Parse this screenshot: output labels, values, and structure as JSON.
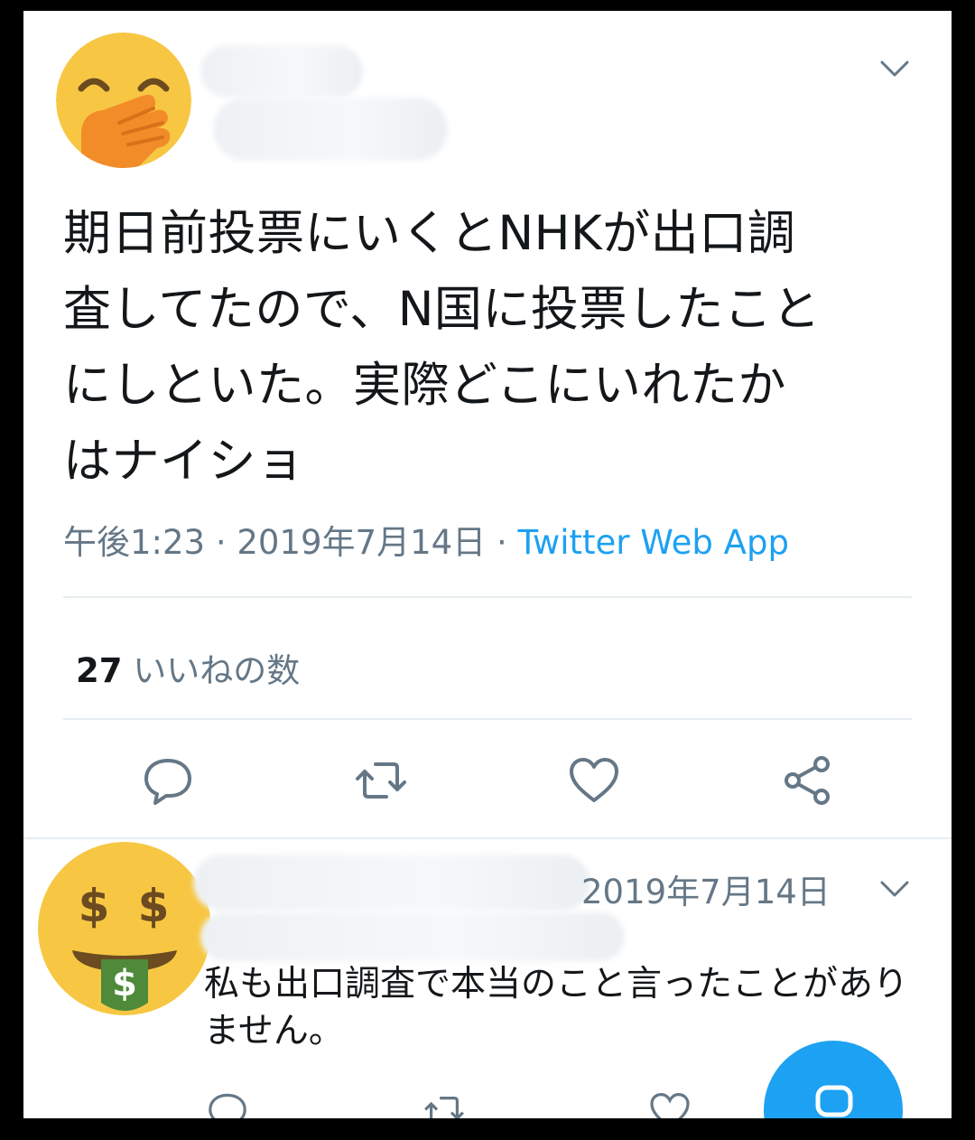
{
  "tweet": {
    "text_lines": [
      "期日前投票にいくとNHKが出口調",
      "査してたので、N国に投票したこと",
      "にしといた。実際どこにいれたか",
      "はナイショ"
    ],
    "time": "午後1:23",
    "separator": " · ",
    "date": "2019年7月14日",
    "source": "Twitter Web App",
    "likes_count": "27",
    "likes_label": "いいねの数",
    "avatar_icon": "face-with-hand-over-mouth-emoji",
    "actions": [
      "reply-icon",
      "retweet-icon",
      "like-icon",
      "share-icon"
    ]
  },
  "reply": {
    "date": "2019年7月14日",
    "text": "私も出口調査で本当のこと言ったことがありません。",
    "avatar_icon": "money-mouth-face-emoji"
  },
  "fab": {
    "icon": "compose-icon"
  },
  "colors": {
    "text": "#14171a",
    "secondary": "#657786",
    "link": "#1da1f2",
    "divider": "#e6ecf0"
  }
}
